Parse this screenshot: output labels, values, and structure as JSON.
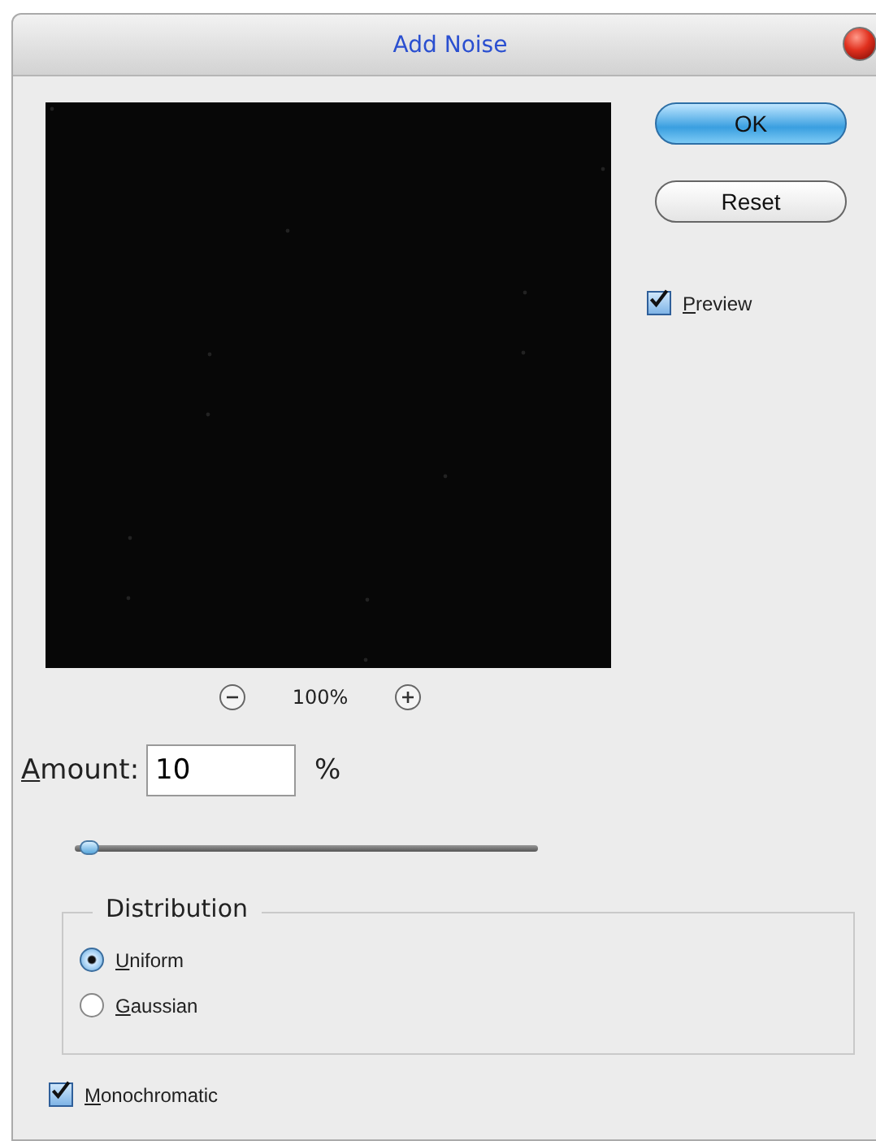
{
  "window": {
    "title": "Add Noise"
  },
  "preview": {
    "kind": "picture",
    "zoom": "100%"
  },
  "buttons": [
    {
      "label": "OK",
      "kind": "default"
    },
    {
      "label": "Reset",
      "kind": "normal"
    }
  ],
  "preview_toggle": {
    "label": "Preview",
    "checked": true
  },
  "amount": {
    "label": "Amount:",
    "value": "10",
    "unit": "%",
    "level": 0.025
  },
  "distribution": {
    "title": "Distribution",
    "options": [
      {
        "label": "Uniform",
        "selected": true
      },
      {
        "label": "Gaussian",
        "selected": false
      }
    ]
  },
  "monochromatic": {
    "label": "Monochromatic",
    "checked": true
  }
}
